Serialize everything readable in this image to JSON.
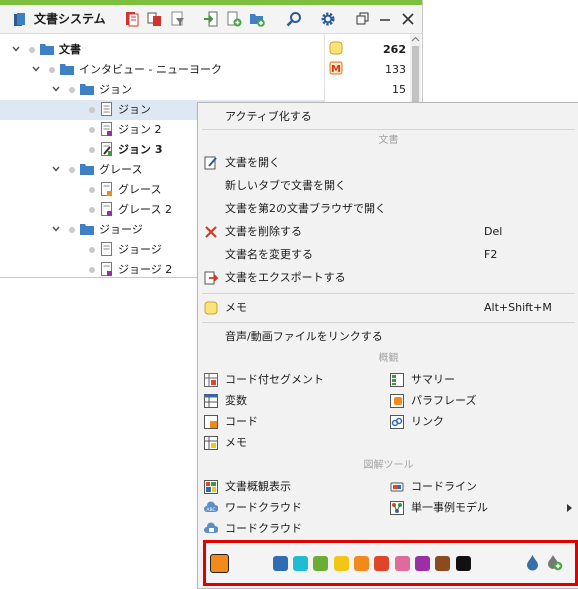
{
  "toolbar": {
    "title": "文書システム",
    "icons": [
      "document-system-icon",
      "new-document-icon",
      "copy-documents-icon",
      "filter-icon",
      "import-icon",
      "new-set-icon",
      "new-folder-icon",
      "search-icon",
      "settings-icon",
      "restore-window-icon",
      "minimize-icon",
      "close-icon"
    ]
  },
  "tree": {
    "rows": [
      {
        "label": "文書",
        "count": "262",
        "bold": true,
        "memo": "memo-yellow-icon"
      },
      {
        "label": "インタビュー - ニューヨーク",
        "count": "133",
        "memo": "memo-m-icon"
      },
      {
        "label": "ジョン",
        "count": "15"
      },
      {
        "label": "ジョン",
        "selected": true
      },
      {
        "label": "ジョン 2"
      },
      {
        "label": "ジョン 3",
        "bold": true
      },
      {
        "label": "グレース"
      },
      {
        "label": "グレース"
      },
      {
        "label": "グレース 2"
      },
      {
        "label": "ジョージ"
      },
      {
        "label": "ジョージ"
      },
      {
        "label": "ジョージ 2"
      }
    ]
  },
  "menu": {
    "activate": "アクティブ化する",
    "section_document": "文書",
    "open": "文書を開く",
    "open_new_tab": "新しいタブで文書を開く",
    "open_second_browser": "文書を第2の文書ブラウザで開く",
    "delete": "文書を削除する",
    "delete_shortcut": "Del",
    "rename": "文書名を変更する",
    "rename_shortcut": "F2",
    "export": "文書をエクスポートする",
    "memo": "メモ",
    "memo_shortcut": "Alt+Shift+M",
    "link_media": "音声/動画ファイルをリンクする",
    "section_overview": "概観",
    "overview": {
      "coded_segments": "コード付セグメント",
      "summary": "サマリー",
      "variables": "変数",
      "paraphrase": "パラフレーズ",
      "codes": "コード",
      "links": "リンク",
      "memos": "メモ"
    },
    "section_visual": "図解ツール",
    "visual": {
      "doc_portrait": "文書概観表示",
      "codeline": "コードライン",
      "word_cloud": "ワードクラウド",
      "single_case_model": "単一事例モデル",
      "code_cloud": "コードクラウド"
    },
    "colors": {
      "selected": "#f28a1c",
      "palette": [
        "#2e6db4",
        "#1fbdd1",
        "#6aae35",
        "#f3c616",
        "#f18a1b",
        "#e0452a",
        "#e06a9a",
        "#9a2fa6",
        "#8c4a1f",
        "#111111"
      ]
    }
  }
}
